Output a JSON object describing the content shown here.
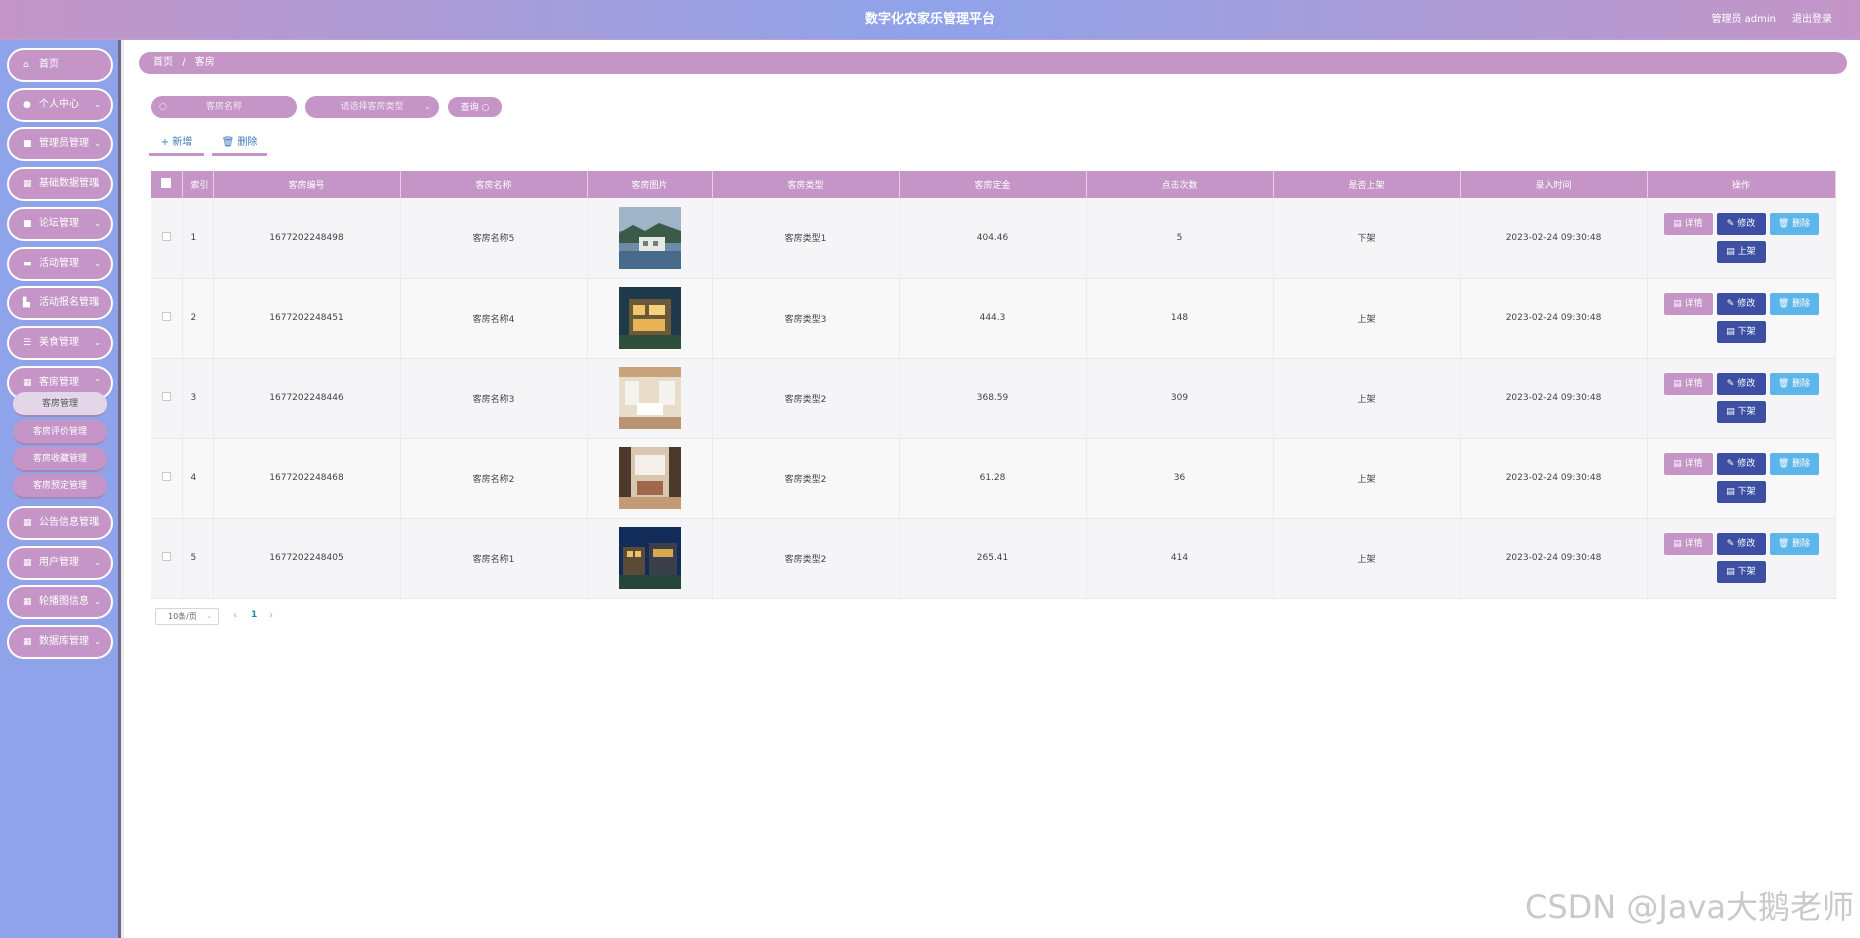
{
  "header": {
    "title": "数字化农家乐管理平台",
    "user": "管理员 admin",
    "logout": "退出登录"
  },
  "sidebar": {
    "items": [
      {
        "label": "首页",
        "icon": "home-icon"
      },
      {
        "label": "个人中心",
        "icon": "user-icon"
      },
      {
        "label": "管理员管理",
        "icon": "lock-icon"
      },
      {
        "label": "基础数据管理",
        "icon": "grid-icon"
      },
      {
        "label": "论坛管理",
        "icon": "lock-icon"
      },
      {
        "label": "活动管理",
        "icon": "ticket-icon"
      },
      {
        "label": "活动报名管理",
        "icon": "bar-chart-icon"
      },
      {
        "label": "美食管理",
        "icon": "list-icon"
      },
      {
        "label": "客房管理",
        "icon": "grid-icon"
      },
      {
        "label": "公告信息管理",
        "icon": "grid-icon"
      },
      {
        "label": "用户管理",
        "icon": "grid-icon"
      },
      {
        "label": "轮播图信息",
        "icon": "grid-icon"
      },
      {
        "label": "数据库管理",
        "icon": "grid-icon"
      }
    ],
    "sub_items": [
      "客房管理",
      "客房评价管理",
      "客房收藏管理",
      "客房预定管理"
    ]
  },
  "breadcrumb": {
    "home": "首页",
    "separator": "/",
    "current": "客房"
  },
  "search": {
    "name_placeholder": "客房名称",
    "type_placeholder": "请选择客房类型",
    "query_label": "查询"
  },
  "toolbar": {
    "add_label": "新增",
    "delete_label": "删除"
  },
  "table": {
    "columns": [
      "索引",
      "客房编号",
      "客房名称",
      "客房图片",
      "客房类型",
      "客房定金",
      "点击次数",
      "是否上架",
      "录入时间",
      "操作"
    ],
    "rows": [
      {
        "index": "1",
        "code": "1677202248498",
        "name": "客房名称5",
        "type": "客房类型1",
        "deposit": "404.46",
        "clicks": "5",
        "status": "下架",
        "time": "2023-02-24 09:30:48",
        "shelf_action": "上架"
      },
      {
        "index": "2",
        "code": "1677202248451",
        "name": "客房名称4",
        "type": "客房类型3",
        "deposit": "444.3",
        "clicks": "148",
        "status": "上架",
        "time": "2023-02-24 09:30:48",
        "shelf_action": "下架"
      },
      {
        "index": "3",
        "code": "1677202248446",
        "name": "客房名称3",
        "type": "客房类型2",
        "deposit": "368.59",
        "clicks": "309",
        "status": "上架",
        "time": "2023-02-24 09:30:48",
        "shelf_action": "下架"
      },
      {
        "index": "4",
        "code": "1677202248468",
        "name": "客房名称2",
        "type": "客房类型2",
        "deposit": "61.28",
        "clicks": "36",
        "status": "上架",
        "time": "2023-02-24 09:30:48",
        "shelf_action": "下架"
      },
      {
        "index": "5",
        "code": "1677202248405",
        "name": "客房名称1",
        "type": "客房类型2",
        "deposit": "265.41",
        "clicks": "414",
        "status": "上架",
        "time": "2023-02-24 09:30:48",
        "shelf_action": "下架"
      }
    ],
    "actions": {
      "detail": "详情",
      "edit": "修改",
      "delete": "删除"
    }
  },
  "pager": {
    "page_size": "10条/页",
    "current_page": "1"
  },
  "watermark": "CSDN @Java大鹅老师",
  "colors": {
    "accent": "#c495c6",
    "sidebar": "#8fa3ea",
    "edit_button": "#3d4fa3",
    "delete_button": "#5cb6ea"
  }
}
